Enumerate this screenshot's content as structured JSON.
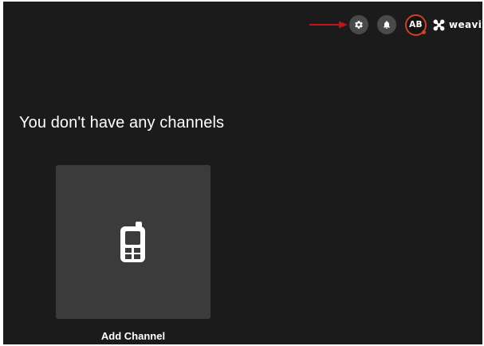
{
  "header": {
    "icons": {
      "settings": "gear-icon",
      "notifications": "bell-icon",
      "brand_logo": "weavix-logo-icon"
    },
    "avatar": {
      "initials": "AB",
      "ring_color": "#c9412a",
      "status_color": "#d9412a"
    },
    "brand": {
      "name": "weavix"
    }
  },
  "annotation": {
    "arrow_color": "#c0141b"
  },
  "main": {
    "empty_title": "You don't have any channels",
    "add_card": {
      "label": "Add Channel",
      "icon": "radio-device-icon"
    }
  },
  "colors": {
    "background": "#1b1b1b",
    "card": "#3b3b3b",
    "icon_button": "#4a4a4a",
    "text": "#ffffff"
  }
}
